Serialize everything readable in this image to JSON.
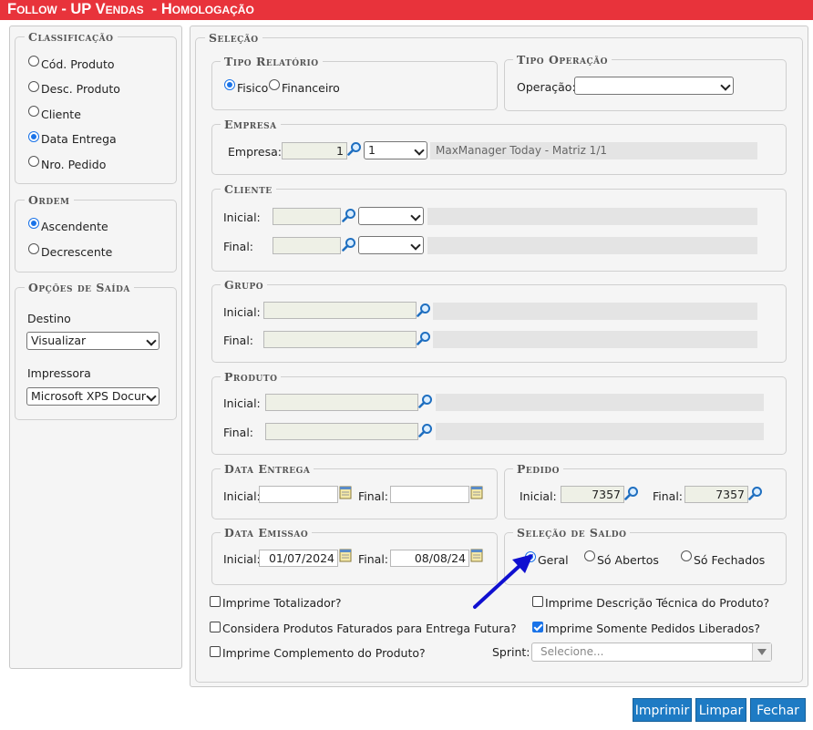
{
  "title": "Follow - UP Vendas  - Homologação",
  "classificacao": {
    "legend": "Classificação",
    "options": [
      "Cód. Produto",
      "Desc. Produto",
      "Cliente",
      "Data Entrega",
      "Nro. Pedido"
    ],
    "selected": "Data Entrega"
  },
  "ordem": {
    "legend": "Ordem",
    "options": [
      "Ascendente",
      "Decrescente"
    ],
    "selected": "Ascendente"
  },
  "opcoes_saida": {
    "legend": "Opções de Saída",
    "destino_label": "Destino",
    "destino_value": "Visualizar",
    "impressora_label": "Impressora",
    "impressora_value": "Microsoft XPS Docur"
  },
  "selecao": {
    "legend": "Seleção"
  },
  "tipo_relatorio": {
    "legend": "Tipo Relatório",
    "options": [
      "Fisico",
      "Financeiro"
    ],
    "selected": "Fisico"
  },
  "tipo_operacao": {
    "legend": "Tipo Operação",
    "label": "Operação:",
    "value": ""
  },
  "empresa": {
    "legend": "Empresa",
    "label": "Empresa:",
    "code": "1",
    "select_value": "1",
    "name": "MaxManager Today - Matriz 1/1"
  },
  "cliente": {
    "legend": "Cliente",
    "inicial_label": "Inicial:",
    "final_label": "Final:"
  },
  "grupo": {
    "legend": "Grupo",
    "inicial_label": "Inicial:",
    "final_label": "Final:"
  },
  "produto": {
    "legend": "Produto",
    "inicial_label": "Inicial:",
    "final_label": "Final:"
  },
  "data_entrega": {
    "legend": "Data Entrega",
    "inicial_label": "Inicial:",
    "final_label": "Final:",
    "inicial_value": "",
    "final_value": ""
  },
  "pedido": {
    "legend": "Pedido",
    "inicial_label": "Inicial:",
    "final_label": "Final:",
    "inicial_value": "7357",
    "final_value": "7357"
  },
  "data_emissao": {
    "legend": "Data Emissao",
    "inicial_label": "Inicial:",
    "final_label": "Final:",
    "inicial_value": "01/07/2024",
    "final_value": "08/08/24"
  },
  "selecao_saldo": {
    "legend": "Seleção de Saldo",
    "options": [
      "Geral",
      "Só Abertos",
      "Só Fechados"
    ],
    "selected": "Geral"
  },
  "checks": {
    "totalizador": {
      "label": "Imprime Totalizador?",
      "checked": false
    },
    "faturados": {
      "label": "Considera Produtos Faturados para Entrega Futura?",
      "checked": false
    },
    "complemento": {
      "label": "Imprime Complemento do Produto?",
      "checked": false
    },
    "descricao_tecnica": {
      "label": "Imprime Descrição Técnica do Produto?",
      "checked": false
    },
    "somente_liberados": {
      "label": "Imprime Somente Pedidos Liberados?",
      "checked": true
    }
  },
  "sprint": {
    "label": "Sprint:",
    "placeholder": "Selecione..."
  },
  "buttons": {
    "imprimir": "Imprimir",
    "limpar": "Limpar",
    "fechar": "Fechar"
  },
  "colors": {
    "title_bar": "#e8333b",
    "button": "#1e7bc4",
    "radio_selected": "#1a73e8",
    "arrow": "#1010d0"
  }
}
